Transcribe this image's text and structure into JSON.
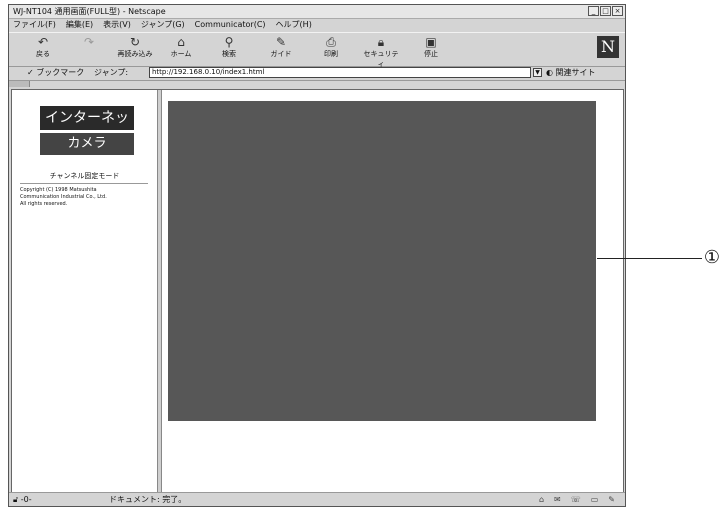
{
  "window": {
    "title": "WJ-NT104 通用画面(FULL型) - Netscape",
    "buttons": [
      "_",
      "□",
      "×"
    ]
  },
  "menu": {
    "items": [
      "ファイル(F)",
      "編集(E)",
      "表示(V)",
      "ジャンプ(G)",
      "Communicator(C)",
      "ヘルプ(H)"
    ]
  },
  "toolbar": {
    "back_label": "戻る",
    "forward_label": "",
    "reload_label": "再読み込み",
    "home_label": "ホーム",
    "search_label": "検索",
    "guide_label": "ガイド",
    "print_label": "印刷",
    "security_label": "セキュリティ",
    "stop_label": "停止",
    "logo": "N"
  },
  "location": {
    "bookmarks_label": "ブックマーク",
    "jump_label": "ジャンプ:",
    "url": "http://192.168.0.10/index1.html",
    "related_label": "関連サイト"
  },
  "sidebar": {
    "banner_line1": "インターネット",
    "banner_line2": "カメラ",
    "mode_label": "チャンネル固定モード",
    "copyright_lines": [
      "Copyright (C) 1998 Matsushita",
      "Communication Industrial Co., Ltd.",
      "All rights reserved."
    ]
  },
  "status": {
    "text": "ドキュメント: 完了。"
  },
  "annotation": {
    "label": "①"
  },
  "colors": {
    "video_area": "#575757",
    "banner_dark": "#2a2a2a"
  }
}
